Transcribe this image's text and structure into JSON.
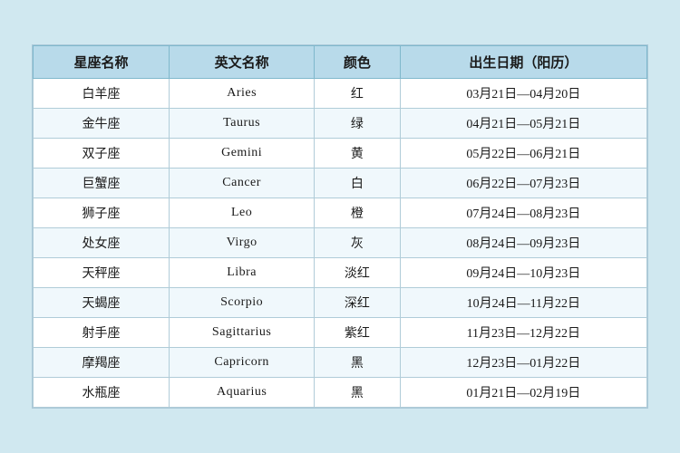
{
  "table": {
    "headers": [
      "星座名称",
      "英文名称",
      "颜色",
      "出生日期（阳历）"
    ],
    "rows": [
      {
        "cn": "白羊座",
        "en": "Aries",
        "color": "红",
        "date": "03月21日—04月20日"
      },
      {
        "cn": "金牛座",
        "en": "Taurus",
        "color": "绿",
        "date": "04月21日—05月21日"
      },
      {
        "cn": "双子座",
        "en": "Gemini",
        "color": "黄",
        "date": "05月22日—06月21日"
      },
      {
        "cn": "巨蟹座",
        "en": "Cancer",
        "color": "白",
        "date": "06月22日—07月23日"
      },
      {
        "cn": "狮子座",
        "en": "Leo",
        "color": "橙",
        "date": "07月24日—08月23日"
      },
      {
        "cn": "处女座",
        "en": "Virgo",
        "color": "灰",
        "date": "08月24日—09月23日"
      },
      {
        "cn": "天秤座",
        "en": "Libra",
        "color": "淡红",
        "date": "09月24日—10月23日"
      },
      {
        "cn": "天蝎座",
        "en": "Scorpio",
        "color": "深红",
        "date": "10月24日—11月22日"
      },
      {
        "cn": "射手座",
        "en": "Sagittarius",
        "color": "紫红",
        "date": "11月23日—12月22日"
      },
      {
        "cn": "摩羯座",
        "en": "Capricorn",
        "color": "黑",
        "date": "12月23日—01月22日"
      },
      {
        "cn": "水瓶座",
        "en": "Aquarius",
        "color": "黑",
        "date": "01月21日—02月19日"
      }
    ]
  }
}
